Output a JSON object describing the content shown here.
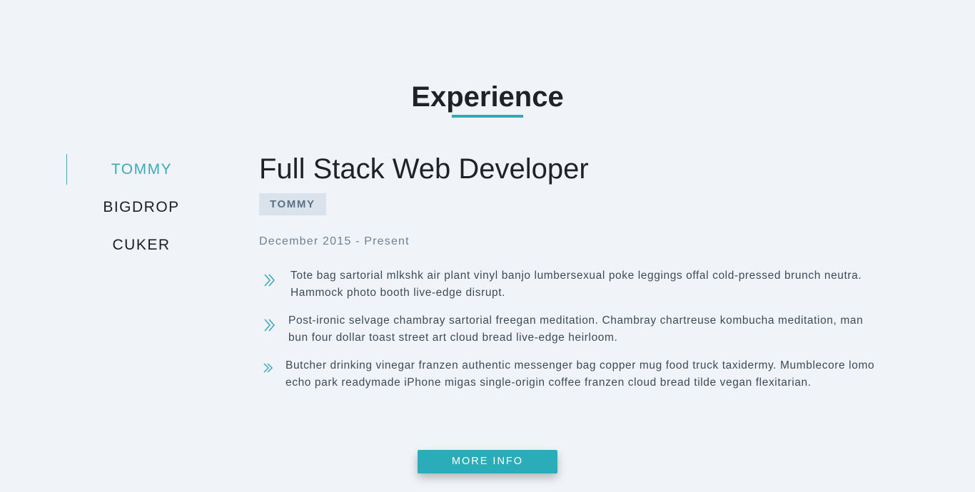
{
  "section": {
    "title": "Experience"
  },
  "tabs": [
    {
      "label": "TOMMY",
      "active": true
    },
    {
      "label": "BIGDROP",
      "active": false
    },
    {
      "label": "CUKER",
      "active": false
    }
  ],
  "job": {
    "title": "Full Stack Web Developer",
    "company": "TOMMY",
    "dates": "December 2015 - Present",
    "bullets": [
      "Tote bag sartorial mlkshk air plant vinyl banjo lumbersexual poke leggings offal cold-pressed brunch neutra. Hammock photo booth live-edge disrupt.",
      "Post-ironic selvage chambray sartorial freegan meditation. Chambray chartreuse kombucha meditation, man bun four dollar toast street art cloud bread live-edge heirloom.",
      "Butcher drinking vinegar franzen authentic messenger bag copper mug food truck taxidermy. Mumblecore lomo echo park readymade iPhone migas single-origin coffee franzen cloud bread tilde vegan flexitarian."
    ],
    "bullet_icon": "double-chevron-right-icon"
  },
  "actions": {
    "more_info_label": "MORE INFO"
  },
  "colors": {
    "background": "#f0f4f8",
    "accent": "#2aadb9",
    "tab_active": "#3fa9b5",
    "badge_bg": "#dae3ec",
    "badge_text": "#5b7186"
  }
}
